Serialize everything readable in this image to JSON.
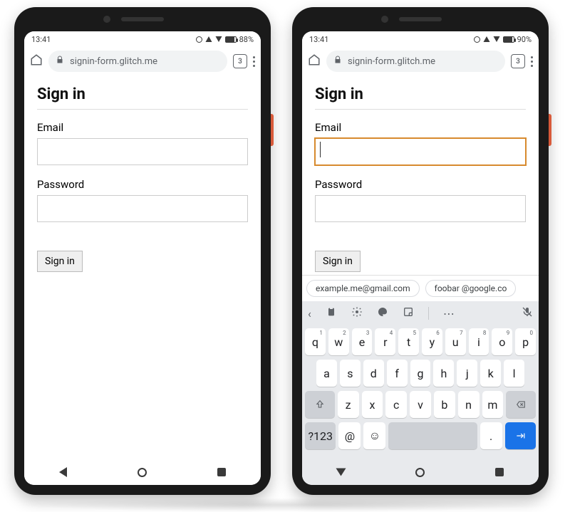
{
  "left": {
    "status": {
      "time": "13:41",
      "battery": "88%"
    },
    "omnibox": {
      "url": "signin-form.glitch.me",
      "tab_count": "3"
    },
    "page": {
      "heading": "Sign in",
      "email_label": "Email",
      "email_value": "",
      "password_label": "Password",
      "password_value": "",
      "submit_label": "Sign in"
    }
  },
  "right": {
    "status": {
      "time": "13:41",
      "battery": "90%"
    },
    "omnibox": {
      "url": "signin-form.glitch.me",
      "tab_count": "3"
    },
    "page": {
      "heading": "Sign in",
      "email_label": "Email",
      "email_value": "",
      "password_label": "Password",
      "password_value": "",
      "submit_label": "Sign in"
    },
    "autofill": {
      "chip1": "example.me@gmail.com",
      "chip2": "foobar @google.co"
    },
    "keyboard": {
      "row1": [
        "q",
        "w",
        "e",
        "r",
        "t",
        "y",
        "u",
        "i",
        "o",
        "p"
      ],
      "row1_sup": [
        "1",
        "2",
        "3",
        "4",
        "5",
        "6",
        "7",
        "8",
        "9",
        "0"
      ],
      "row2": [
        "a",
        "s",
        "d",
        "f",
        "g",
        "h",
        "j",
        "k",
        "l"
      ],
      "row3": [
        "z",
        "x",
        "c",
        "v",
        "b",
        "n",
        "m"
      ],
      "sym_key": "?123",
      "at_key": "@",
      "dot_key": "."
    }
  }
}
